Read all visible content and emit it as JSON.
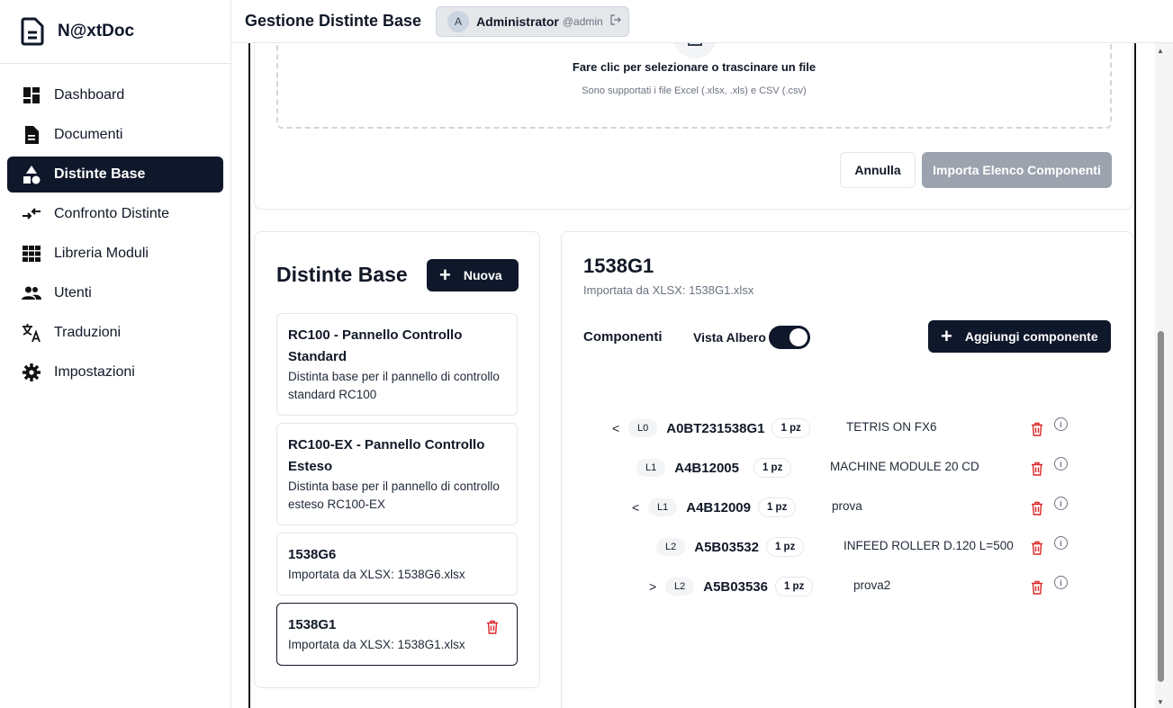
{
  "app": {
    "name": "N@xtDoc"
  },
  "sidebar": {
    "items": [
      {
        "label": "Dashboard",
        "icon": "dashboard-icon",
        "active": false
      },
      {
        "label": "Documenti",
        "icon": "document-icon",
        "active": false
      },
      {
        "label": "Distinte Base",
        "icon": "shapes-icon",
        "active": true
      },
      {
        "label": "Confronto Distinte",
        "icon": "compare-arrows-icon",
        "active": false
      },
      {
        "label": "Libreria Moduli",
        "icon": "grid-icon",
        "active": false
      },
      {
        "label": "Utenti",
        "icon": "users-icon",
        "active": false
      },
      {
        "label": "Traduzioni",
        "icon": "translate-icon",
        "active": false
      },
      {
        "label": "Impostazioni",
        "icon": "gear-icon",
        "active": false
      }
    ]
  },
  "header": {
    "title": "Gestione Distinte Base",
    "user": {
      "initial": "A",
      "name": "Administrator",
      "handle": "@admin"
    }
  },
  "import": {
    "dropzone_title": "Fare clic per selezionare o trascinare un file",
    "dropzone_sub": "Sono supportati i file Excel (.xlsx, .xls) e CSV (.csv)",
    "cancel_label": "Annulla",
    "import_label": "Importa Elenco Componenti"
  },
  "bom_list": {
    "title": "Distinte Base",
    "new_label": "Nuova",
    "items": [
      {
        "name": "RC100 - Pannello Controllo Standard",
        "desc": "Distinta base per il pannello di controllo standard RC100"
      },
      {
        "name": "RC100-EX - Pannello Controllo Esteso",
        "desc": "Distinta base per il pannello di controllo esteso RC100-EX"
      },
      {
        "name": "1538G6",
        "desc": "Importata da XLSX: 1538G6.xlsx"
      },
      {
        "name": "1538G1",
        "desc": "Importata da XLSX: 1538G1.xlsx",
        "selected": true
      }
    ]
  },
  "detail": {
    "title": "1538G1",
    "subtitle": "Importata da XLSX: 1538G1.xlsx",
    "components_label": "Componenti",
    "tree_view_label": "Vista Albero",
    "tree_view_on": true,
    "add_label": "Aggiungi componente",
    "rows": [
      {
        "chevron": "<",
        "level": "L0",
        "code": "A0BT231538G1",
        "qty": "1 pz",
        "desc": "TETRIS ON FX6"
      },
      {
        "chevron": "",
        "level": "L1",
        "code": "A4B12005",
        "qty": "1 pz",
        "desc": "MACHINE MODULE 20 CD"
      },
      {
        "chevron": "<",
        "level": "L1",
        "code": "A4B12009",
        "qty": "1 pz",
        "desc": "prova"
      },
      {
        "chevron": "",
        "level": "L2",
        "code": "A5B03532",
        "qty": "1 pz",
        "desc": "INFEED ROLLER D.120 L=500"
      },
      {
        "chevron": ">",
        "level": "L2",
        "code": "A5B03536",
        "qty": "1 pz",
        "desc": "prova2"
      }
    ]
  }
}
